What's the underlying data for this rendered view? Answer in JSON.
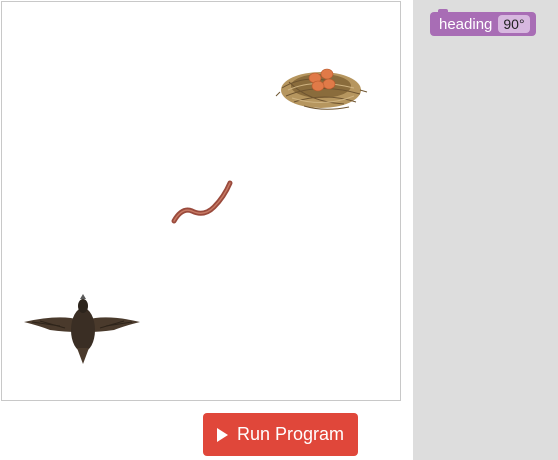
{
  "stage": {
    "sprites": [
      {
        "name": "nest-with-eggs"
      },
      {
        "name": "worm"
      },
      {
        "name": "bird"
      }
    ]
  },
  "controls": {
    "run_label": "Run Program",
    "run_icon": "play-icon"
  },
  "toolbox": {
    "blocks": [
      {
        "label": "heading",
        "value": "90°",
        "color": "#a86db5"
      }
    ]
  },
  "colors": {
    "run_button": "#e0473a",
    "toolbox_bg": "#dddddd",
    "block": "#a86db5"
  }
}
